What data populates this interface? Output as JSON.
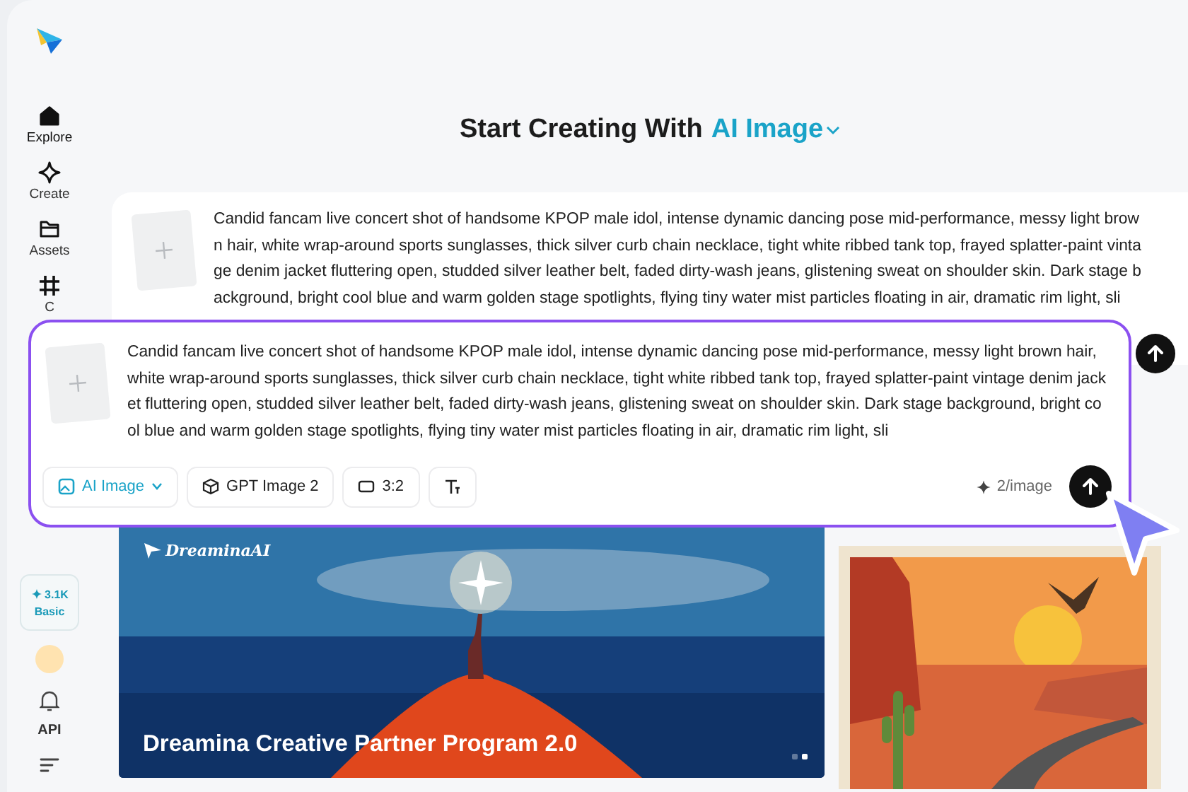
{
  "sidebar": {
    "items": [
      {
        "kind": "home",
        "label": "Explore",
        "selected": true
      },
      {
        "kind": "sparkle",
        "label": "Create",
        "selected": false
      },
      {
        "kind": "folder",
        "label": "Assets",
        "selected": false
      },
      {
        "kind": "crop",
        "label": "C",
        "selected": false
      }
    ],
    "credits": {
      "amount": "3.1K",
      "plan": "Basic"
    },
    "api_label": "API"
  },
  "heading": {
    "text": "Start Creating With",
    "mode": "AI Image"
  },
  "prompt_back": {
    "text": "Candid fancam live concert shot of handsome KPOP male idol, intense dynamic dancing pose mid-performance, messy light brown hair, white wrap-around sports sunglasses, thick silver curb chain necklace, tight white ribbed tank top, frayed splatter-paint vintage denim jacket fluttering open, studded silver leather belt, faded dirty-wash jeans, glistening sweat on shoulder skin. Dark stage background, bright cool blue and warm golden stage spotlights, flying tiny water mist particles floating in air, dramatic rim light, sli"
  },
  "prompt_front": {
    "text": "Candid fancam live concert shot of handsome KPOP male idol, intense dynamic dancing pose mid-performance, messy light brown hair, white wrap-around sports sunglasses, thick silver curb chain necklace, tight white ribbed tank top, frayed splatter-paint vintage denim jacket fluttering open, studded silver leather belt, faded dirty-wash jeans, glistening sweat on shoulder skin. Dark stage background, bright cool blue and warm golden stage spotlights, flying tiny water mist particles floating in air, dramatic rim light, sli",
    "toolbar": [
      {
        "kind": "mode",
        "label": "AI Image"
      },
      {
        "kind": "model",
        "label": "GPT Image 2"
      },
      {
        "kind": "ratio",
        "label": "3:2"
      },
      {
        "kind": "text-tool"
      }
    ],
    "cost": "2/image"
  },
  "banner": {
    "logo": "DreaminaAI",
    "title": "Dreamina Creative Partner Program 2.0",
    "slides": [
      {
        "selected": false
      },
      {
        "selected": true
      }
    ]
  }
}
